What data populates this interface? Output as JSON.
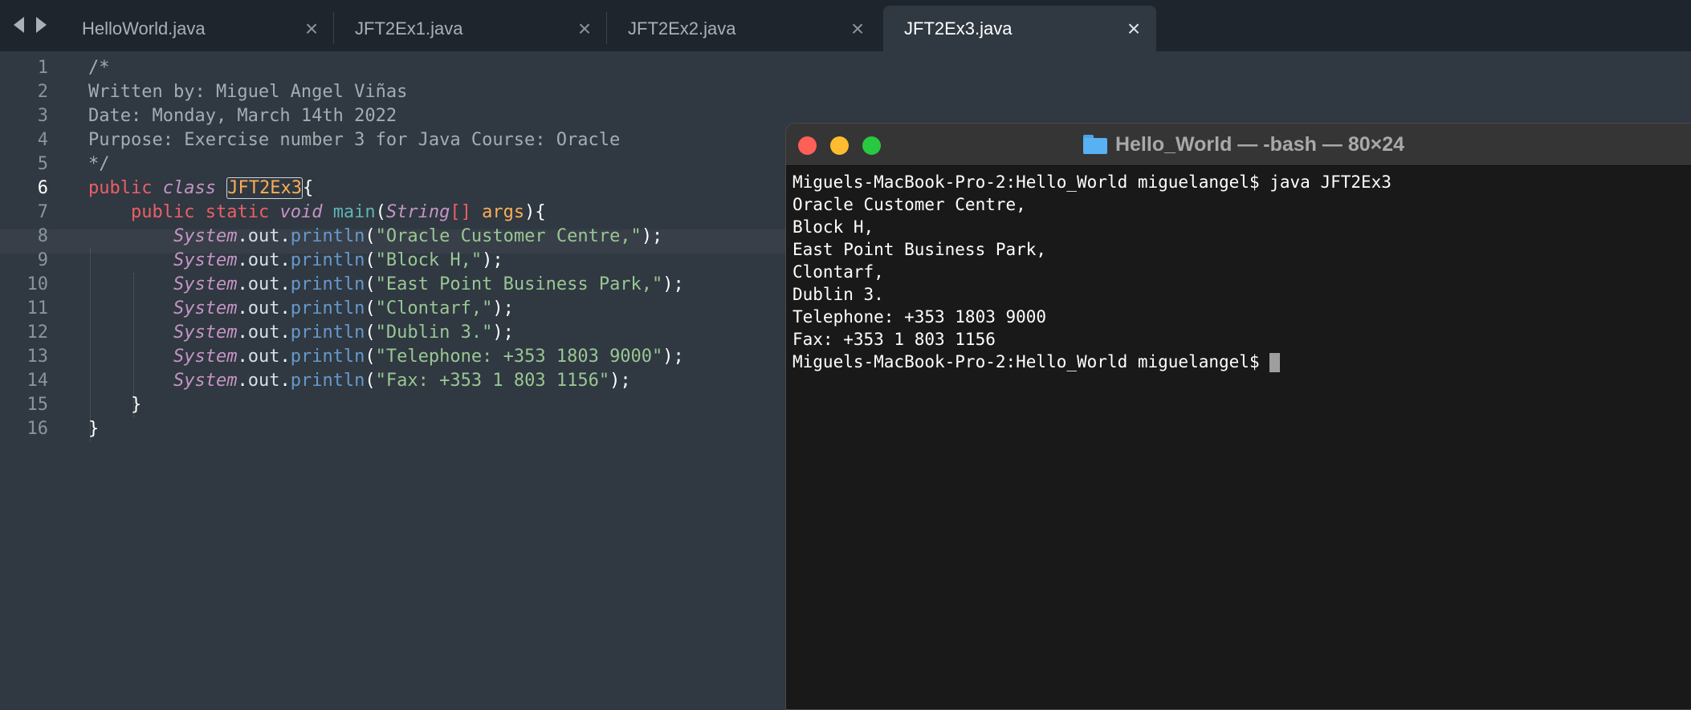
{
  "nav": {
    "back_icon": "arrow-left-icon",
    "forward_icon": "arrow-right-icon"
  },
  "tabs": [
    {
      "label": "HelloWorld.java",
      "close": "×"
    },
    {
      "label": "JFT2Ex1.java",
      "close": "×"
    },
    {
      "label": "JFT2Ex2.java",
      "close": "×"
    },
    {
      "label": "JFT2Ex3.java",
      "close": "×",
      "active": true
    }
  ],
  "editor": {
    "current_line": 6,
    "line_numbers": [
      "1",
      "2",
      "3",
      "4",
      "5",
      "6",
      "7",
      "8",
      "9",
      "10",
      "11",
      "12",
      "13",
      "14",
      "15",
      "16"
    ],
    "code": {
      "l1": "/*",
      "l2": "Written by: Miguel Angel Viñas",
      "l3": "Date: Monday, March 14th 2022",
      "l4": "Purpose: Exercise number 3 for Java Course: Oracle",
      "l5": "*/",
      "l6": {
        "kw_public": "public",
        "kw_class": "class",
        "class_name": "JFT2Ex3",
        "brace": "{"
      },
      "l7": {
        "kw_public": "public",
        "kw_static": "static",
        "kw_void": "void",
        "method": "main",
        "paren_open": "(",
        "param_type": "String",
        "brackets": "[]",
        "param": "args",
        "close": "){"
      },
      "l8": {
        "obj": "System",
        "dot1": ".",
        "prop": "out",
        "dot2": ".",
        "meth": "println",
        "open": "(",
        "str": "\"Oracle Customer Centre,\"",
        "close": ");"
      },
      "l9": {
        "obj": "System",
        "dot1": ".",
        "prop": "out",
        "dot2": ".",
        "meth": "println",
        "open": "(",
        "str": "\"Block H,\"",
        "close": ");"
      },
      "l10": {
        "obj": "System",
        "dot1": ".",
        "prop": "out",
        "dot2": ".",
        "meth": "println",
        "open": "(",
        "str": "\"East Point Business Park,\"",
        "close": ");"
      },
      "l11": {
        "obj": "System",
        "dot1": ".",
        "prop": "out",
        "dot2": ".",
        "meth": "println",
        "open": "(",
        "str": "\"Clontarf,\"",
        "close": ");"
      },
      "l12": {
        "obj": "System",
        "dot1": ".",
        "prop": "out",
        "dot2": ".",
        "meth": "println",
        "open": "(",
        "str": "\"Dublin 3.\"",
        "close": ");"
      },
      "l13": {
        "obj": "System",
        "dot1": ".",
        "prop": "out",
        "dot2": ".",
        "meth": "println",
        "open": "(",
        "str": "\"Telephone: +353 1803 9000\"",
        "close": ");"
      },
      "l14": {
        "obj": "System",
        "dot1": ".",
        "prop": "out",
        "dot2": ".",
        "meth": "println",
        "open": "(",
        "str": "\"Fax: +353 1 803 1156\"",
        "close": ");"
      },
      "l15": "}",
      "l16": "}"
    }
  },
  "terminal": {
    "title": "Hello_World — -bash — 80×24",
    "folder_icon": "folder-icon",
    "lines": [
      "Miguels-MacBook-Pro-2:Hello_World miguelangel$ java JFT2Ex3",
      "Oracle Customer Centre,",
      "Block H,",
      "East Point Business Park,",
      "Clontarf,",
      "Dublin 3.",
      "Telephone: +353 1803 9000",
      "Fax: +353 1 803 1156"
    ],
    "prompt": "Miguels-MacBook-Pro-2:Hello_World miguelangel$ "
  },
  "colors": {
    "editor_bg": "#303841",
    "tabbar_bg": "#1f252c",
    "keyword": "#ec5f66",
    "italic_type": "#c594c5",
    "class_name": "#f9ae58",
    "method": "#6699cc",
    "string": "#99c794",
    "terminal_bg": "#191919"
  }
}
